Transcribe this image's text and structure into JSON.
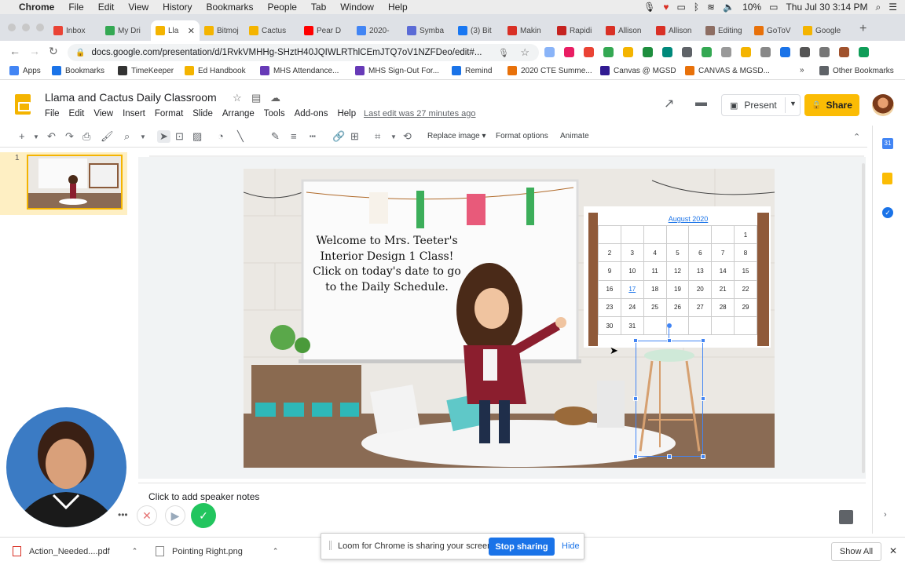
{
  "menubar": {
    "app": "Chrome",
    "items": [
      "File",
      "Edit",
      "View",
      "History",
      "Bookmarks",
      "People",
      "Tab",
      "Window",
      "Help"
    ],
    "battery": "10%",
    "clock": "Thu Jul 30  3:14 PM"
  },
  "tabs": [
    {
      "label": "Inbox",
      "color": "#ea4335"
    },
    {
      "label": "My Dri",
      "color": "#34a853"
    },
    {
      "label": "Lla",
      "color": "#f4b400",
      "active": true
    },
    {
      "label": "Bitmoj",
      "color": "#f4b400"
    },
    {
      "label": "Cactus",
      "color": "#f4b400"
    },
    {
      "label": "Pear D",
      "color": "#ff0000"
    },
    {
      "label": "2020-",
      "color": "#4285f4"
    },
    {
      "label": "Symba",
      "color": "#5b6bd6"
    },
    {
      "label": "(3) Bit",
      "color": "#1877f2"
    },
    {
      "label": "Makin",
      "color": "#d93025"
    },
    {
      "label": "Rapidi",
      "color": "#c5221f"
    },
    {
      "label": "Allison",
      "color": "#d93025"
    },
    {
      "label": "Allison",
      "color": "#d93025"
    },
    {
      "label": "Editing",
      "color": "#8d6e63"
    },
    {
      "label": "GoToV",
      "color": "#e8710a"
    },
    {
      "label": "Google",
      "color": "#f4b400"
    }
  ],
  "address": {
    "url": "docs.google.com/presentation/d/1RvkVMHHg-SHztH40JQIWLRThlCEmJTQ7oV1NZFDeo/edit#..."
  },
  "bookmarks": [
    {
      "label": "Apps",
      "color": "#4285f4"
    },
    {
      "label": "Bookmarks",
      "color": "#1a73e8"
    },
    {
      "label": "TimeKeeper",
      "color": "#333333"
    },
    {
      "label": "Ed Handbook",
      "color": "#f4b400"
    },
    {
      "label": "MHS Attendance...",
      "color": "#673ab7"
    },
    {
      "label": "MHS Sign-Out For...",
      "color": "#673ab7"
    },
    {
      "label": "Remind",
      "color": "#1a73e8"
    },
    {
      "label": "2020 CTE Summe...",
      "color": "#e8710a"
    },
    {
      "label": "Canvas @ MGSD",
      "color": "#311b92"
    },
    {
      "label": "CANVAS & MGSD...",
      "color": "#e8710a"
    },
    {
      "label": "Other Bookmarks",
      "color": "#5f6368"
    }
  ],
  "doc": {
    "title": "Llama and Cactus Daily Classroom",
    "menus": [
      "File",
      "Edit",
      "View",
      "Insert",
      "Format",
      "Slide",
      "Arrange",
      "Tools",
      "Add-ons",
      "Help"
    ],
    "last_edit": "Last edit was 27 minutes ago",
    "present_label": "Present",
    "share_label": "Share"
  },
  "toolbar": {
    "replace_image": "Replace image ▾",
    "format_options": "Format options",
    "animate": "Animate"
  },
  "filmstrip": {
    "slide_number": "1"
  },
  "slide": {
    "welcome_lines": [
      "Welcome to Mrs. Teeter's",
      "Interior Design 1 Class!",
      "Click on today's date to go",
      "to the Daily Schedule."
    ],
    "calendar": {
      "month": "August 2020",
      "weeks": [
        [
          "",
          "",
          "",
          "",
          "",
          "",
          "1"
        ],
        [
          "2",
          "3",
          "4",
          "5",
          "6",
          "7",
          "8"
        ],
        [
          "9",
          "10",
          "11",
          "12",
          "13",
          "14",
          "15"
        ],
        [
          "16",
          "17",
          "18",
          "19",
          "20",
          "21",
          "22"
        ],
        [
          "23",
          "24",
          "25",
          "26",
          "27",
          "28",
          "29"
        ],
        [
          "30",
          "31",
          "",
          "",
          "",
          "",
          ""
        ]
      ],
      "linked_date": "17"
    }
  },
  "notes": {
    "placeholder": "Click to add speaker notes"
  },
  "downloads": [
    {
      "label": "Action_Needed....pdf"
    },
    {
      "label": "Pointing Right.png"
    }
  ],
  "download_bar": {
    "show_all": "Show All"
  },
  "loom": {
    "message": "Loom for Chrome is sharing your screen.",
    "stop": "Stop sharing",
    "hide": "Hide"
  }
}
